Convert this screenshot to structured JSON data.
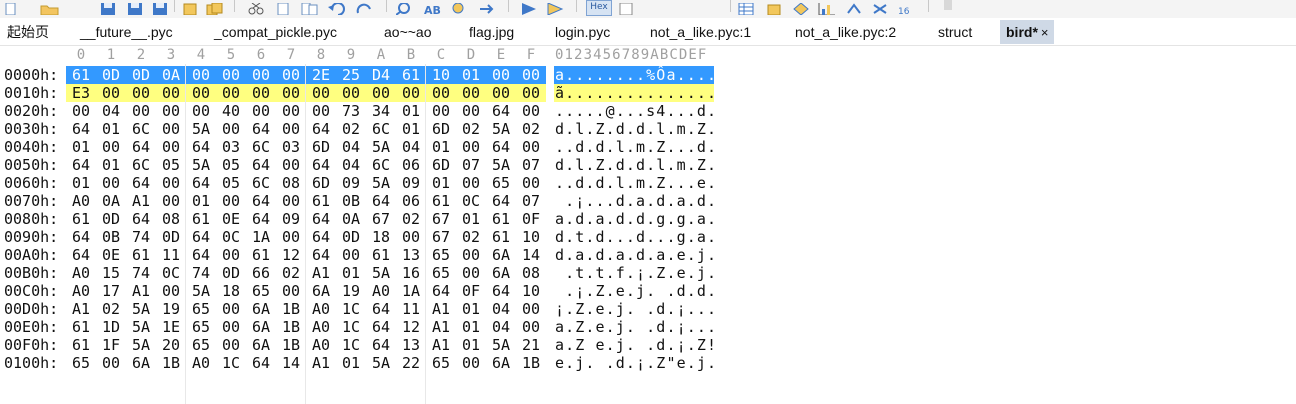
{
  "toolbar": {
    "icons": [
      "new-file-icon",
      "open-folder-icon",
      "save-icon",
      "save-all-icon",
      "save-as-icon",
      "paste-icon",
      "copy-icon",
      "cut-icon",
      "copy-file-icon",
      "paste-file-icon",
      "undo-icon",
      "redo-icon",
      "find-icon",
      "replace-icon",
      "find-next-icon",
      "goto-icon",
      "bookmark-icon",
      "hex-view-icon",
      "settings-icon",
      "table-icon",
      "list-icon",
      "tools-icon",
      "chart-icon",
      "compare-icon",
      "calculator-icon",
      "scrollbar-icon"
    ],
    "hex_button_label": "Hex"
  },
  "tabs": [
    {
      "label": "起始页"
    },
    {
      "label": "__future__.pyc"
    },
    {
      "label": "_compat_pickle.pyc"
    },
    {
      "label": "ao~~ao"
    },
    {
      "label": "flag.jpg"
    },
    {
      "label": "login.pyc"
    },
    {
      "label": "not_a_like.pyc:1"
    },
    {
      "label": "not_a_like.pyc:2"
    },
    {
      "label": "struct"
    },
    {
      "label": "bird*",
      "active": true,
      "close": "×"
    }
  ],
  "hex": {
    "column_headers": [
      "0",
      "1",
      "2",
      "3",
      "4",
      "5",
      "6",
      "7",
      "8",
      "9",
      "A",
      "B",
      "C",
      "D",
      "E",
      "F"
    ],
    "ascii_header": "0123456789ABCDEF",
    "colors": {
      "selection": "#3399ff",
      "highlight": "#ffff80",
      "stripe": "#f2f2f2"
    },
    "rows": [
      {
        "offset": "0000h:",
        "bytes": [
          "61",
          "0D",
          "0D",
          "0A",
          "00",
          "00",
          "00",
          "00",
          "2E",
          "25",
          "D4",
          "61",
          "10",
          "01",
          "00",
          "00"
        ],
        "ascii": "a........%Ôa....",
        "state": "selected"
      },
      {
        "offset": "0010h:",
        "bytes": [
          "E3",
          "00",
          "00",
          "00",
          "00",
          "00",
          "00",
          "00",
          "00",
          "00",
          "00",
          "00",
          "00",
          "00",
          "00",
          "00"
        ],
        "ascii": "ã...............",
        "state": "highlight"
      },
      {
        "offset": "0020h:",
        "bytes": [
          "00",
          "04",
          "00",
          "00",
          "00",
          "40",
          "00",
          "00",
          "00",
          "73",
          "34",
          "01",
          "00",
          "00",
          "64",
          "00"
        ],
        "ascii": ".....@...s4...d.",
        "state": "normal"
      },
      {
        "offset": "0030h:",
        "bytes": [
          "64",
          "01",
          "6C",
          "00",
          "5A",
          "00",
          "64",
          "00",
          "64",
          "02",
          "6C",
          "01",
          "6D",
          "02",
          "5A",
          "02"
        ],
        "ascii": "d.l.Z.d.d.l.m.Z.",
        "state": "normal"
      },
      {
        "offset": "0040h:",
        "bytes": [
          "01",
          "00",
          "64",
          "00",
          "64",
          "03",
          "6C",
          "03",
          "6D",
          "04",
          "5A",
          "04",
          "01",
          "00",
          "64",
          "00"
        ],
        "ascii": "..d.d.l.m.Z...d.",
        "state": "normal"
      },
      {
        "offset": "0050h:",
        "bytes": [
          "64",
          "01",
          "6C",
          "05",
          "5A",
          "05",
          "64",
          "00",
          "64",
          "04",
          "6C",
          "06",
          "6D",
          "07",
          "5A",
          "07"
        ],
        "ascii": "d.l.Z.d.d.l.m.Z.",
        "state": "normal"
      },
      {
        "offset": "0060h:",
        "bytes": [
          "01",
          "00",
          "64",
          "00",
          "64",
          "05",
          "6C",
          "08",
          "6D",
          "09",
          "5A",
          "09",
          "01",
          "00",
          "65",
          "00"
        ],
        "ascii": "..d.d.l.m.Z...e.",
        "state": "normal"
      },
      {
        "offset": "0070h:",
        "bytes": [
          "A0",
          "0A",
          "A1",
          "00",
          "01",
          "00",
          "64",
          "00",
          "61",
          "0B",
          "64",
          "06",
          "61",
          "0C",
          "64",
          "07"
        ],
        "ascii": " .¡...d.a.d.a.d.",
        "state": "normal"
      },
      {
        "offset": "0080h:",
        "bytes": [
          "61",
          "0D",
          "64",
          "08",
          "61",
          "0E",
          "64",
          "09",
          "64",
          "0A",
          "67",
          "02",
          "67",
          "01",
          "61",
          "0F"
        ],
        "ascii": "a.d.a.d.d.g.g.a.",
        "state": "normal"
      },
      {
        "offset": "0090h:",
        "bytes": [
          "64",
          "0B",
          "74",
          "0D",
          "64",
          "0C",
          "1A",
          "00",
          "64",
          "0D",
          "18",
          "00",
          "67",
          "02",
          "61",
          "10"
        ],
        "ascii": "d.t.d...d...g.a.",
        "state": "normal"
      },
      {
        "offset": "00A0h:",
        "bytes": [
          "64",
          "0E",
          "61",
          "11",
          "64",
          "00",
          "61",
          "12",
          "64",
          "00",
          "61",
          "13",
          "65",
          "00",
          "6A",
          "14"
        ],
        "ascii": "d.a.d.a.d.a.e.j.",
        "state": "normal"
      },
      {
        "offset": "00B0h:",
        "bytes": [
          "A0",
          "15",
          "74",
          "0C",
          "74",
          "0D",
          "66",
          "02",
          "A1",
          "01",
          "5A",
          "16",
          "65",
          "00",
          "6A",
          "08"
        ],
        "ascii": " .t.t.f.¡.Z.e.j.",
        "state": "normal"
      },
      {
        "offset": "00C0h:",
        "bytes": [
          "A0",
          "17",
          "A1",
          "00",
          "5A",
          "18",
          "65",
          "00",
          "6A",
          "19",
          "A0",
          "1A",
          "64",
          "0F",
          "64",
          "10"
        ],
        "ascii": " .¡.Z.e.j. .d.d.",
        "state": "normal"
      },
      {
        "offset": "00D0h:",
        "bytes": [
          "A1",
          "02",
          "5A",
          "19",
          "65",
          "00",
          "6A",
          "1B",
          "A0",
          "1C",
          "64",
          "11",
          "A1",
          "01",
          "04",
          "00"
        ],
        "ascii": "¡.Z.e.j. .d.¡...",
        "state": "normal"
      },
      {
        "offset": "00E0h:",
        "bytes": [
          "61",
          "1D",
          "5A",
          "1E",
          "65",
          "00",
          "6A",
          "1B",
          "A0",
          "1C",
          "64",
          "12",
          "A1",
          "01",
          "04",
          "00"
        ],
        "ascii": "a.Z.e.j. .d.¡...",
        "state": "normal"
      },
      {
        "offset": "00F0h:",
        "bytes": [
          "61",
          "1F",
          "5A",
          "20",
          "65",
          "00",
          "6A",
          "1B",
          "A0",
          "1C",
          "64",
          "13",
          "A1",
          "01",
          "5A",
          "21"
        ],
        "ascii": "a.Z e.j. .d.¡.Z!",
        "state": "normal"
      },
      {
        "offset": "0100h:",
        "bytes": [
          "65",
          "00",
          "6A",
          "1B",
          "A0",
          "1C",
          "64",
          "14",
          "A1",
          "01",
          "5A",
          "22",
          "65",
          "00",
          "6A",
          "1B"
        ],
        "ascii": "e.j. .d.¡.Z\"e.j.",
        "state": "normal"
      }
    ]
  }
}
